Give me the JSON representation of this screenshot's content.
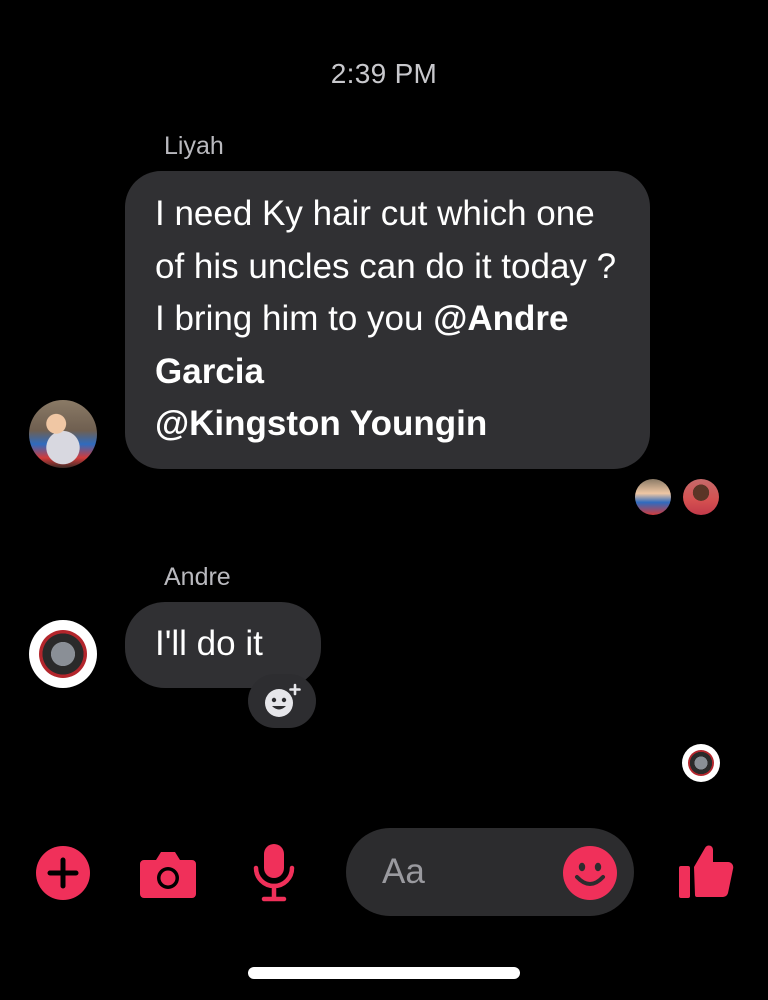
{
  "header": {
    "timestamp": "2:39 PM"
  },
  "messages": [
    {
      "sender": "Liyah",
      "text_before": "I need Ky hair cut which one of his uncles can do it today ? I bring him to you ",
      "mention_1": "@Andre Garcia",
      "mention_2": "@Kingston Youngin"
    },
    {
      "sender": "Andre",
      "text": "I'll do it"
    }
  ],
  "composer": {
    "placeholder": "Aa"
  },
  "icons": {
    "plus": "plus-circle-icon",
    "camera": "camera-icon",
    "mic": "microphone-icon",
    "emoji": "smiley-icon",
    "like": "thumbs-up-icon",
    "react": "add-reaction-icon"
  },
  "colors": {
    "accent": "#f0305a",
    "bubble": "#303033",
    "background": "#000000"
  }
}
